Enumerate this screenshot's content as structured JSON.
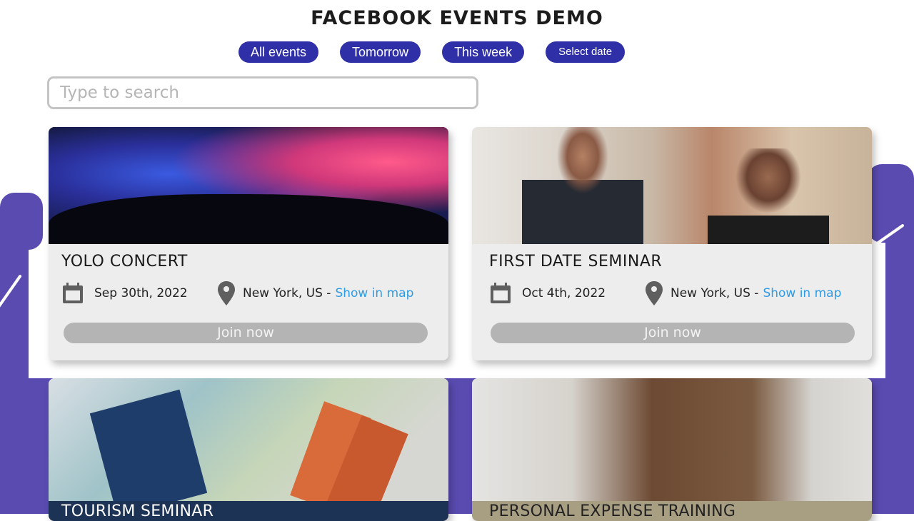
{
  "header": {
    "title": "FACEBOOK EVENTS DEMO"
  },
  "filters": [
    {
      "label": "All events"
    },
    {
      "label": "Tomorrow"
    },
    {
      "label": "This week"
    },
    {
      "label": "Select date"
    }
  ],
  "search": {
    "placeholder": "Type to search",
    "value": ""
  },
  "colors": {
    "accent": "#2f2fa8",
    "background_purple": "#5a4bb1",
    "link": "#2d9be6",
    "join_button": "#b4b4b4"
  },
  "events": [
    {
      "title": "YOLO CONCERT",
      "date": "Sep 30th, 2022",
      "location": "New York, US -",
      "map_link": "Show in map",
      "join_label": "Join now",
      "image": "concert-crowd-photo"
    },
    {
      "title": "FIRST DATE SEMINAR",
      "date": "Oct 4th, 2022",
      "location": "New York, US -",
      "map_link": "Show in map",
      "join_label": "Join now",
      "image": "cafe-couple-photo"
    },
    {
      "title": "TOURISM SEMINAR",
      "image": "map-travel-photo"
    },
    {
      "title": "PERSONAL EXPENSE TRAINING",
      "image": "credit-card-photo"
    }
  ]
}
